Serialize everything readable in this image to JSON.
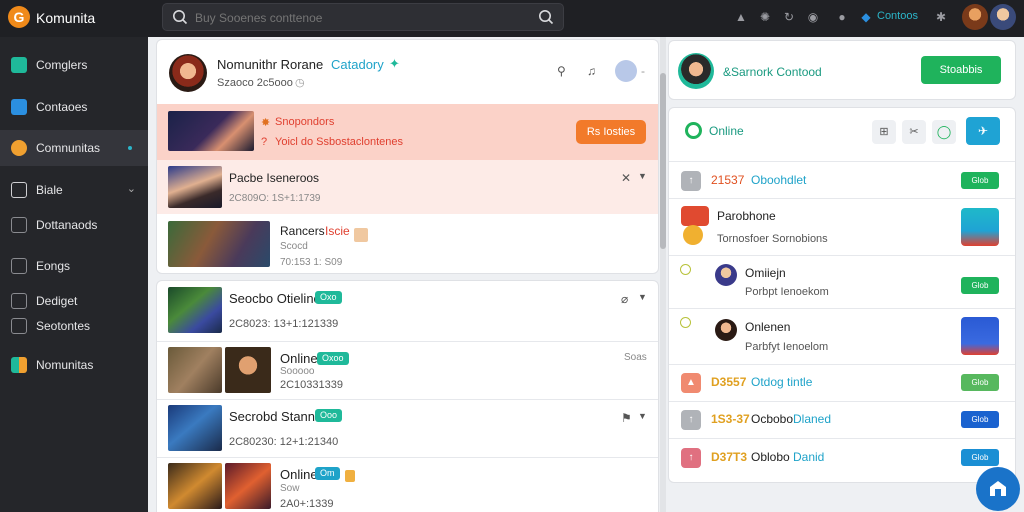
{
  "app": {
    "brand": "Komunita",
    "logo_letter": "G"
  },
  "search": {
    "placeholder": "Buy Sooenes conttenoe"
  },
  "topbar": {
    "label": "Contoos"
  },
  "sidebar": {
    "items": [
      {
        "label": "Comglers",
        "icon": "cube-icon",
        "color": "#1fb99a"
      },
      {
        "label": "Contaoes",
        "icon": "square-icon",
        "color": "#2b8fe0"
      },
      {
        "label": "Comnunitas",
        "icon": "people-icon",
        "color": "#f0a030",
        "active": true
      },
      {
        "label": "Biale",
        "icon": "home-icon",
        "color": "#cfcfd2",
        "chevron": true
      },
      {
        "label": "Dottanaods",
        "icon": "grid-icon",
        "color": "#8a8b90"
      },
      {
        "label": "Eongs",
        "icon": "folder-icon",
        "color": "#8a8b90"
      },
      {
        "label": "Dediget",
        "icon": "book-icon",
        "color": "#8a8b90"
      },
      {
        "label": "Seotontes",
        "icon": "list-icon",
        "color": "#8a8b90"
      },
      {
        "label": "Nomunitas",
        "icon": "chart-icon",
        "color": "#1fb99a"
      }
    ]
  },
  "feed": {
    "header": {
      "title": "Nomunithr Rorane",
      "tag": "Catadory",
      "sub": "Szaoco 2c5ooo"
    },
    "promo": {
      "title": "Snopondors",
      "sub": "Yoicl do Ssbostaclontenes",
      "button": "Rs Iosties"
    },
    "post1": {
      "title": "Pacbe Iseneroos",
      "time": "2C809O: 1S+1:1739"
    },
    "post2": {
      "title": "Rancers",
      "hot": "Iscie",
      "sub": "Scocd",
      "time": "70:153 1: S09"
    },
    "card2": [
      {
        "title": "Seocbo Otieline",
        "badge": "Oxo",
        "time": "2C8023: 13+1:121339"
      },
      {
        "title": "Online",
        "badge": "Oxoo",
        "sub": "Sooooo",
        "time": "2C10331339",
        "extra": "Soas"
      },
      {
        "title": "Secrobd Stanne",
        "badge": "Ooo",
        "time": "2C80230: 12+1:21340"
      },
      {
        "title": "Online",
        "badge": "Om",
        "sub": "Sow",
        "time": "2A0+:1339"
      }
    ]
  },
  "right": {
    "profile": {
      "title": "&Sarnork Contood",
      "button": "Stoabbis"
    },
    "online": {
      "label": "Online"
    },
    "rows": [
      {
        "num": "21537",
        "name": "Oboohdlet",
        "badge": "Glob",
        "badge_color": "#1fb35c"
      },
      {
        "title": "Parobhone",
        "sub": "Tornosfoer Sornobions"
      },
      {
        "title": "Omiiejn",
        "sub": "Porbpt Ienoekom",
        "badge": "Glob",
        "badge_color": "#1fb35c"
      },
      {
        "title": "Onlenen",
        "sub": "Parbfyt Ienoelom"
      },
      {
        "num": "D3557",
        "name": "Otdog tintle",
        "badge": "Glob",
        "badge_color": "#57b85e"
      },
      {
        "num": "1S3-37",
        "name": "Ocbobo",
        "name2": "Dlaned",
        "badge": "Glob",
        "badge_color": "#1a62cf"
      },
      {
        "num": "D37T3",
        "name": "Oblobo",
        "name2": "Danid",
        "badge": "Glob",
        "badge_color": "#1a8fd4"
      }
    ]
  }
}
